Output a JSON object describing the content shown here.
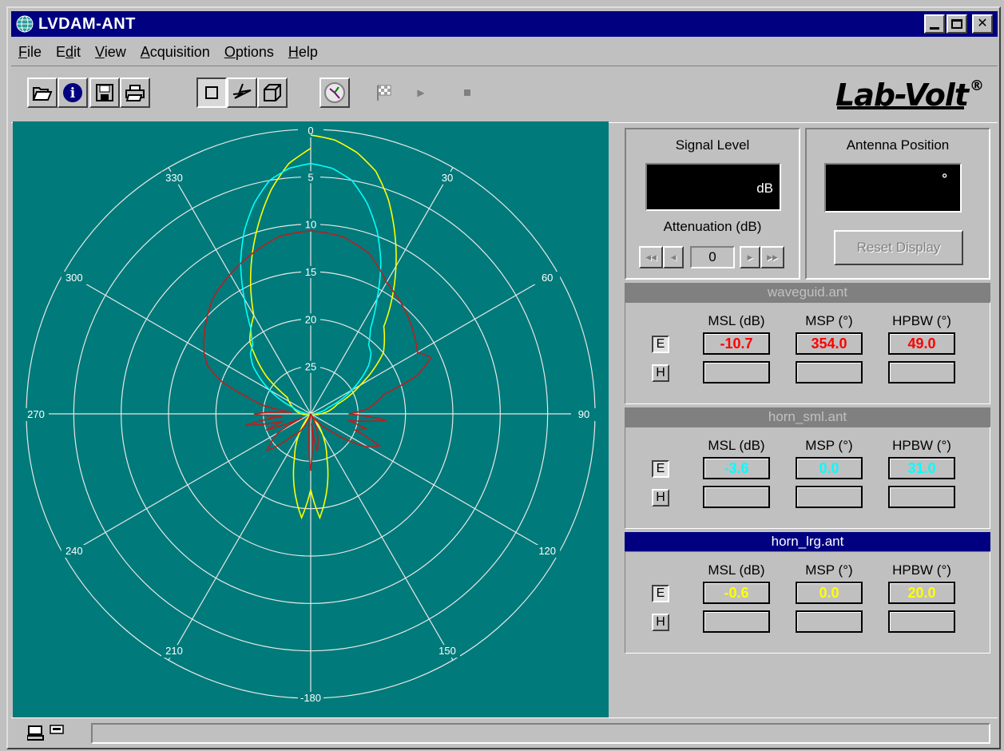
{
  "window": {
    "title": "LVDAM-ANT"
  },
  "menu": [
    "File",
    "Edit",
    "View",
    "Acquisition",
    "Options",
    "Help"
  ],
  "menu_underline": [
    "F",
    "d",
    "V",
    "A",
    "O",
    "H"
  ],
  "logo": {
    "text": "Lab-Volt",
    "reg": "®"
  },
  "toolbar": {
    "icons": [
      "open-folder-icon",
      "info-icon",
      "save-icon",
      "print-icon",
      "rectangular-view-icon",
      "polar-view-icon",
      "3d-view-icon",
      "signal-meter-icon",
      "checkered-flag-icon",
      "play-icon",
      "stop-icon"
    ]
  },
  "chart_data": {
    "type": "polar",
    "angle_labels": [
      "0",
      "30",
      "60",
      "90",
      "120",
      "150",
      "-180",
      "210",
      "240",
      "270",
      "300",
      "330"
    ],
    "radial_labels": [
      "5",
      "10",
      "15",
      "20",
      "25"
    ],
    "series": [
      {
        "color": "#ffff00",
        "angles": [
          0,
          5,
          10,
          15,
          20,
          25,
          30,
          35,
          40,
          45,
          50,
          55,
          60,
          70,
          80,
          90,
          110,
          140,
          160,
          170,
          175,
          180,
          185,
          190,
          200,
          220,
          250,
          270,
          290,
          305,
          310,
          315,
          320,
          325,
          330,
          335,
          340,
          345,
          350,
          355,
          360
        ],
        "values": [
          -0.6,
          -1,
          -2,
          -3.5,
          -6,
          -9,
          -12,
          -15,
          -18,
          -19,
          -20,
          -22,
          -24,
          -27,
          -28,
          -29,
          -30,
          -30,
          -25,
          -21,
          -19,
          -22,
          -19,
          -21,
          -25,
          -30,
          -30,
          -29,
          -28,
          -27,
          -24,
          -22,
          -20,
          -19,
          -18,
          -15,
          -12,
          -9,
          -6,
          -3.5,
          -2,
          -0.6
        ]
      },
      {
        "color": "#00ffff",
        "angles": [
          0,
          5,
          10,
          15,
          20,
          25,
          30,
          35,
          40,
          45,
          50,
          55,
          60,
          70,
          90,
          140,
          180,
          220,
          270,
          290,
          300,
          305,
          310,
          315,
          320,
          325,
          330,
          335,
          340,
          345,
          350,
          355,
          360
        ],
        "values": [
          -3.6,
          -4,
          -5,
          -7,
          -9.5,
          -12.5,
          -16,
          -19,
          -20.5,
          -21,
          -22,
          -23.5,
          -25,
          -28,
          -30,
          -30,
          -30,
          -30,
          -30,
          -28,
          -25,
          -23.5,
          -22,
          -21,
          -20.5,
          -19,
          -16,
          -12.5,
          -9.5,
          -7,
          -5,
          -4,
          -3.6
        ]
      },
      {
        "color": "#b82020",
        "angles": [
          0,
          10,
          20,
          30,
          40,
          50,
          60,
          65,
          70,
          75,
          80,
          85,
          90,
          95,
          100,
          105,
          110,
          115,
          120,
          130,
          140,
          150,
          160,
          170,
          175,
          180,
          185,
          190,
          200,
          210,
          220,
          230,
          240,
          245,
          250,
          255,
          260,
          265,
          270,
          275,
          280,
          285,
          290,
          295,
          300,
          310,
          320,
          330,
          340,
          350,
          360
        ],
        "values": [
          -10.7,
          -11,
          -12,
          -14,
          -15,
          -16,
          -17,
          -16,
          -18,
          -22,
          -23,
          -24,
          -26,
          -22,
          -26,
          -24,
          -25,
          -22,
          -23,
          -27,
          -29,
          -30,
          -28,
          -26,
          -29,
          -24,
          -28,
          -30,
          -30,
          -28,
          -27,
          -24,
          -26,
          -29,
          -25,
          -27,
          -23,
          -27,
          -24,
          -28,
          -25,
          -23,
          -20,
          -18,
          -17,
          -15.5,
          -14,
          -13,
          -12,
          -11,
          -10.7
        ]
      }
    ]
  },
  "signal": {
    "title": "Signal Level",
    "unit": "dB"
  },
  "attenuation": {
    "label": "Attenuation (dB)",
    "value": "0",
    "btn_ffwd_left": "◀◀",
    "btn_left": "◀",
    "btn_right": "▶",
    "btn_ffwd_right": "▶▶"
  },
  "antenna": {
    "title": "Antenna Position",
    "value": "°",
    "reset_label": "Reset Display"
  },
  "files": [
    {
      "name": "waveguid.ant",
      "active": false,
      "color": "#ff0000",
      "headers": [
        "MSL (dB)",
        "MSP (°)",
        "HPBW (°)"
      ],
      "e": [
        "-10.7",
        "354.0",
        "49.0"
      ],
      "h": [
        "",
        "",
        ""
      ]
    },
    {
      "name": "horn_sml.ant",
      "active": false,
      "color": "#00ffff",
      "headers": [
        "MSL (dB)",
        "MSP (°)",
        "HPBW (°)"
      ],
      "e": [
        "-3.6",
        "0.0",
        "31.0"
      ],
      "h": [
        "",
        "",
        ""
      ]
    },
    {
      "name": "horn_lrg.ant",
      "active": true,
      "color": "#ffff00",
      "headers": [
        "MSL (dB)",
        "MSP (°)",
        "HPBW (°)"
      ],
      "e": [
        "-0.6",
        "0.0",
        "20.0"
      ],
      "h": [
        "",
        "",
        ""
      ]
    }
  ],
  "eh": {
    "e": "E",
    "h": "H"
  }
}
